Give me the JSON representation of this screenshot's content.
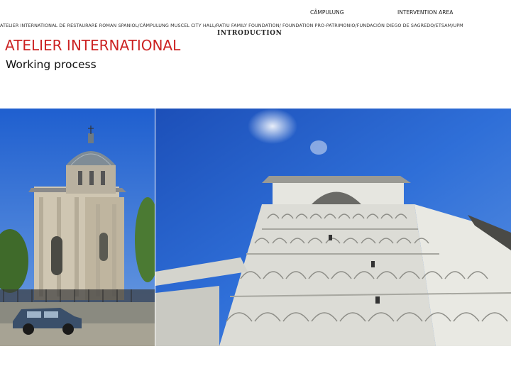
{
  "header": {
    "nav_left": "CÂMPULUNG",
    "nav_right": "INTERVENTION AREA"
  },
  "credits_line": "ATELIER INTERNATIONAL DE RESTAURARE ROMAN SPANIOL/CÂMPULUNG MUSCEL CITY HALL/RATIU FAMILY FOUNDATION/ FOUNDATION PRO-PATRIMONIO/FUNDACIÓN DIEGO DE SAGREDO/ETSAM/UPM",
  "section_label": "INTRODUCTION",
  "title": "ATELIER INTERNATIONAL",
  "subtitle": "Working process",
  "colors": {
    "title": "#cc2222",
    "sky": "#2a5fc4",
    "wall": "#e2e2dc"
  }
}
